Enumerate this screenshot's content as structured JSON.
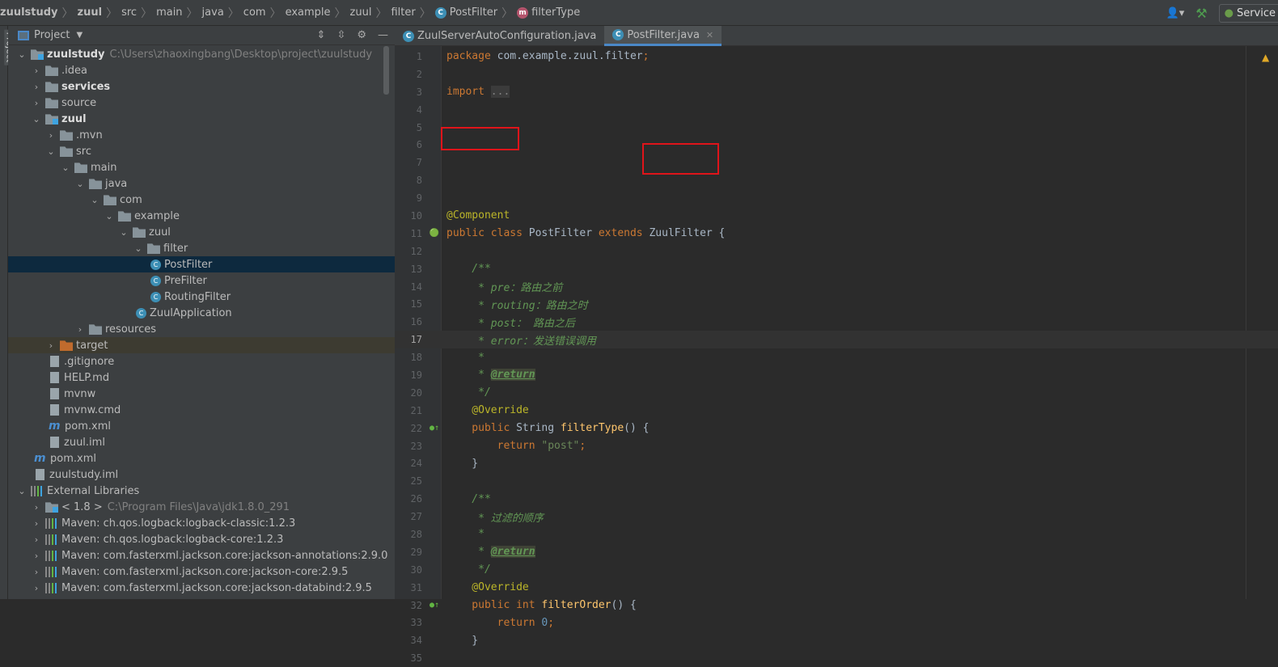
{
  "breadcrumbs": [
    {
      "label": "zuulstudy",
      "bold": true
    },
    {
      "label": "zuul",
      "bold": true
    },
    {
      "label": "src"
    },
    {
      "label": "main"
    },
    {
      "label": "java"
    },
    {
      "label": "com"
    },
    {
      "label": "example"
    },
    {
      "label": "zuul"
    },
    {
      "label": "filter"
    },
    {
      "label": "PostFilter",
      "icon": "class"
    },
    {
      "label": "filterType",
      "icon": "method"
    }
  ],
  "toolbar": {
    "services_label": "Service"
  },
  "side_tab": "Project",
  "project_panel": {
    "title": "Project"
  },
  "tree": [
    {
      "level": 0,
      "arrow": "open",
      "icon": "module-folder",
      "label": "zuulstudy",
      "bold": true,
      "extra": "C:\\Users\\zhaoxingbang\\Desktop\\project\\zuulstudy"
    },
    {
      "level": 1,
      "arrow": "closed",
      "icon": "folder",
      "label": ".idea"
    },
    {
      "level": 1,
      "arrow": "closed",
      "icon": "folder",
      "label": "services",
      "bold": true
    },
    {
      "level": 1,
      "arrow": "closed",
      "icon": "folder",
      "label": "source"
    },
    {
      "level": 1,
      "arrow": "open",
      "icon": "module-folder",
      "label": "zuul",
      "bold": true
    },
    {
      "level": 2,
      "arrow": "closed",
      "icon": "folder",
      "label": ".mvn"
    },
    {
      "level": 2,
      "arrow": "open",
      "icon": "folder",
      "label": "src"
    },
    {
      "level": 3,
      "arrow": "open",
      "icon": "folder",
      "label": "main"
    },
    {
      "level": 4,
      "arrow": "open",
      "icon": "folder",
      "label": "java"
    },
    {
      "level": 5,
      "arrow": "open",
      "icon": "package",
      "label": "com"
    },
    {
      "level": 6,
      "arrow": "open",
      "icon": "package",
      "label": "example"
    },
    {
      "level": 7,
      "arrow": "open",
      "icon": "package",
      "label": "zuul"
    },
    {
      "level": 8,
      "arrow": "open",
      "icon": "package",
      "label": "filter"
    },
    {
      "level": 9,
      "icon": "class",
      "label": "PostFilter",
      "selected": true
    },
    {
      "level": 9,
      "icon": "class",
      "label": "PreFilter"
    },
    {
      "level": 9,
      "icon": "class",
      "label": "RoutingFilter"
    },
    {
      "level": 8,
      "icon": "class",
      "label": "ZuulApplication"
    },
    {
      "level": 4,
      "arrow": "closed",
      "icon": "folder",
      "label": "resources"
    },
    {
      "level": 2,
      "arrow": "closed",
      "icon": "excluded-folder",
      "label": "target",
      "excluded": true
    },
    {
      "level": 2,
      "icon": "file",
      "label": ".gitignore"
    },
    {
      "level": 2,
      "icon": "file",
      "label": "HELP.md"
    },
    {
      "level": 2,
      "icon": "file",
      "label": "mvnw"
    },
    {
      "level": 2,
      "icon": "file",
      "label": "mvnw.cmd"
    },
    {
      "level": 2,
      "icon": "maven",
      "label": "pom.xml"
    },
    {
      "level": 2,
      "icon": "file",
      "label": "zuul.iml"
    },
    {
      "level": 1,
      "icon": "maven",
      "label": "pom.xml"
    },
    {
      "level": 1,
      "icon": "file",
      "label": "zuulstudy.iml"
    },
    {
      "level": 0,
      "arrow": "open",
      "icon": "libraries",
      "label": "External Libraries"
    },
    {
      "level": 1,
      "arrow": "closed",
      "icon": "jdk",
      "label": "< 1.8 >",
      "extra": "C:\\Program Files\\Java\\jdk1.8.0_291"
    },
    {
      "level": 1,
      "arrow": "closed",
      "icon": "library",
      "label": "Maven: ch.qos.logback:logback-classic:1.2.3"
    },
    {
      "level": 1,
      "arrow": "closed",
      "icon": "library",
      "label": "Maven: ch.qos.logback:logback-core:1.2.3"
    },
    {
      "level": 1,
      "arrow": "closed",
      "icon": "library",
      "label": "Maven: com.fasterxml.jackson.core:jackson-annotations:2.9.0"
    },
    {
      "level": 1,
      "arrow": "closed",
      "icon": "library",
      "label": "Maven: com.fasterxml.jackson.core:jackson-core:2.9.5"
    },
    {
      "level": 1,
      "arrow": "closed",
      "icon": "library",
      "label": "Maven: com.fasterxml.jackson.core:jackson-databind:2.9.5"
    }
  ],
  "tabs": [
    {
      "label": "ZuulServerAutoConfiguration.java",
      "active": false
    },
    {
      "label": "PostFilter.java",
      "active": true
    }
  ],
  "code": [
    [
      [
        "k",
        "package "
      ],
      [
        "",
        "com.example.zuul.filter"
      ],
      [
        "k",
        ";"
      ]
    ],
    [],
    [
      [
        "k",
        "import "
      ],
      [
        "g",
        "..."
      ]
    ],
    [],
    [],
    [],
    [],
    [],
    [],
    [
      [
        "a",
        "@Component"
      ]
    ],
    [
      [
        "k",
        "public class "
      ],
      [
        "",
        "PostFilter "
      ],
      [
        "k",
        "extends "
      ],
      [
        "",
        "ZuulFilter {"
      ]
    ],
    [],
    [
      [
        "d",
        "    /**"
      ]
    ],
    [
      [
        "d",
        "     * pre：路由之前"
      ]
    ],
    [
      [
        "d",
        "     * routing：路由之时"
      ]
    ],
    [
      [
        "d",
        "     * post： 路由之后"
      ]
    ],
    [
      [
        "d",
        "     * error：发送错误调用"
      ]
    ],
    [
      [
        "d",
        "     *"
      ]
    ],
    [
      [
        "d",
        "     * "
      ],
      [
        "tag",
        "@return"
      ]
    ],
    [
      [
        "d",
        "     */"
      ]
    ],
    [
      [
        "a",
        "    @Override"
      ]
    ],
    [
      [
        "k",
        "    public "
      ],
      [
        "",
        "String "
      ],
      [
        "f",
        "filterType"
      ],
      [
        "",
        "() {"
      ]
    ],
    [
      [
        "k",
        "        return "
      ],
      [
        "s",
        "\"post\""
      ],
      [
        "k",
        ";"
      ]
    ],
    [
      [
        "",
        "    }"
      ]
    ],
    [],
    [
      [
        "d",
        "    /**"
      ]
    ],
    [
      [
        "d",
        "     * 过滤的顺序"
      ]
    ],
    [
      [
        "d",
        "     *"
      ]
    ],
    [
      [
        "d",
        "     * "
      ],
      [
        "tag",
        "@return"
      ]
    ],
    [
      [
        "d",
        "     */"
      ]
    ],
    [
      [
        "a",
        "    @Override"
      ]
    ],
    [
      [
        "k",
        "    public int "
      ],
      [
        "f",
        "filterOrder"
      ],
      [
        "",
        "() {"
      ]
    ],
    [
      [
        "k",
        "        return "
      ],
      [
        "n",
        "0"
      ],
      [
        "k",
        ";"
      ]
    ],
    [
      [
        "",
        "    }"
      ]
    ],
    []
  ],
  "current_line": 17,
  "gutter_marks": {
    "11": "bean",
    "22": "override",
    "32": "override"
  }
}
